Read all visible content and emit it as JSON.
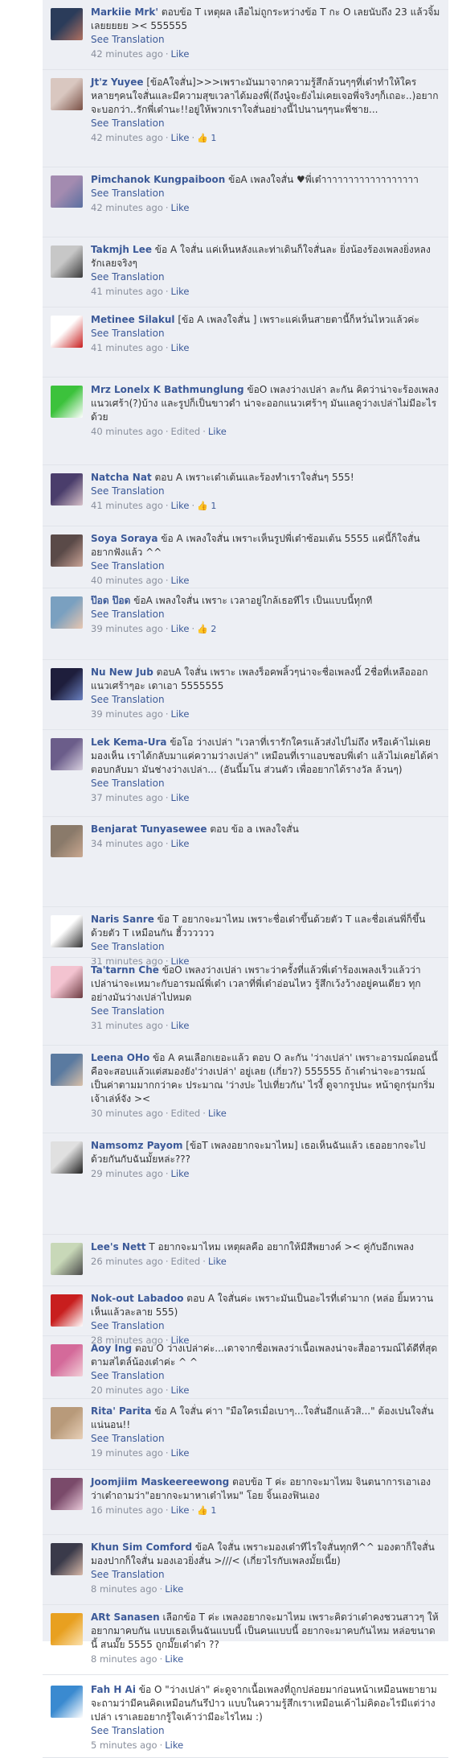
{
  "labels": {
    "see_translation": "See Translation",
    "like": "Like",
    "edited": "Edited",
    "thumb": "👍"
  },
  "comments": [
    {
      "name": "Markiie Mrk'",
      "text": "ตอบข้อ T เหตุผล เลือไม่ถูกระหว่างข้อ T กะ O เลยนับถึง 23 แล้วจิ้มเลยยยยย >< 555555",
      "time": "42 minutes ago",
      "see": true,
      "edited": false,
      "likes": "",
      "avatar": [
        "#2b3c5a",
        "#b07060"
      ]
    },
    {
      "name": "Jt'z Yuyee",
      "text": "[ข้อAใจสั่น]>>>เพราะมันมาจากความรู้สึกล้วนๆๆที่เต๋าทำให้ใครหลายๆคนใจสั่นและมีความสุขเวลาได้มองพี่(ถึงนู๋จะยังไม่เคยเจอพี่จริงๆก็เถอะ..)อยากจะบอกว่า..รักพี่เต๋านะ!!อยู่ให้พวกเราใจสั่นอย่างนี้ไปนานๆๆนะพี่ชาย...",
      "time": "42 minutes ago",
      "see": true,
      "edited": false,
      "likes": "1",
      "avatar": [
        "#d9c7c0",
        "#7a5045"
      ]
    },
    {
      "name": "Pimchanok Kungpaiboon",
      "text": "ข้อA เพลงใจสั่น ♥พี่เต๋าาาาาาาาาาาาาาาาาา",
      "time": "42 minutes ago",
      "see": true,
      "edited": false,
      "likes": "",
      "avatar": [
        "#a38bb0",
        "#5a6fa0"
      ]
    },
    {
      "name": "Takmjh Lee",
      "text": "ข้อ A ใจสั่น แค่เห็นหลังและท่าเดินก็ใจสั่นละ ยิ่งน้องร้องเพลงยิ่งหลงรักเลยจริงๆ",
      "time": "41 minutes ago",
      "see": true,
      "edited": false,
      "likes": "",
      "avatar": [
        "#c7c7c7",
        "#3a3a3a"
      ]
    },
    {
      "name": "Metinee Silakul",
      "text": "[ข้อ A เพลงใจสั่น ] เพราะแค่เห็นสายตานี้ก็หวั่นไหวแล้วค่ะ",
      "time": "41 minutes ago",
      "see": true,
      "edited": false,
      "likes": "",
      "avatar": [
        "#ffffff",
        "#c81e1e"
      ]
    },
    {
      "name": "Mrz Lonelx K Bathmunglung",
      "text": "ข้อO เพลงว่างเปล่า ละกัน คิดว่าน่าจะร้องเพลงแนวเศร้า(?)บ้าง และรูปก็เป็นขาวดำ น่าจะออกแนวเศร้าๆ มันแลดูว่างเปล่าไม่มีอะไรด้วย",
      "time": "40 minutes ago",
      "see": false,
      "edited": true,
      "likes": "",
      "avatar": [
        "#3cc23c",
        "#ffffff"
      ]
    },
    {
      "name": "Natcha Nat",
      "text": "ตอบ A เพราะเต๋าเต้นและร้องทำเราใจสั่นๆ 555!",
      "time": "41 minutes ago",
      "see": true,
      "edited": false,
      "likes": "1",
      "avatar": [
        "#4a3d6b",
        "#d6c0c8"
      ]
    },
    {
      "name": "Soya Soraya",
      "text": "ข้อ A เพลงใจสั่น เพราะเห็นรูปพี่เต๋าซ้อมเต้น 5555 แค่นี้ก็ใจสั่นอยากฟังแล้ว ^^",
      "time": "40 minutes ago",
      "see": true,
      "edited": false,
      "likes": "",
      "avatar": [
        "#5a4a48",
        "#c9a396"
      ]
    },
    {
      "name": "ป๊อด ป๊อด",
      "text": "ข้อA เพลงใจสั่น เพราะ เวลาอยู่ใกล้เธอทีไร เป็นแบบนี้ทุกที",
      "time": "39 minutes ago",
      "see": true,
      "edited": false,
      "likes": "2",
      "avatar": [
        "#7aa0c0",
        "#e8c6b0"
      ]
    },
    {
      "name": "Nu New Jub",
      "text": "ตอบA ใจสั่น เพราะ เพลงร็อคพลิ้วๆน่าจะชื่อเพลงนี้ 2ชื่อที่เหลือออกแนวเศร้าๆอะ เดาเอา 5555555",
      "time": "39 minutes ago",
      "see": true,
      "edited": false,
      "likes": "",
      "avatar": [
        "#1e1e3c",
        "#6a80c0"
      ]
    },
    {
      "name": "Lek Kema-Ura",
      "text": "ข้อโอ ว่างเปล่า \"เวลาที่เรารักใครแล้วส่งไปไม่ถึง หรือเค้าไม่เคยมองเห็น เราได้กลับมาแค่ความว่างเปล่า\" เหมือนที่เราแอบชอบพี่เต๋า แล้วไม่เคยได้ค่าตอบกลับมา มันช่างว่างเปล่า... (อันนี้มโน ส่วนตัว เพื่ออยากได้รางวัล ล้วนๆ)",
      "time": "37 minutes ago",
      "see": true,
      "edited": false,
      "likes": "",
      "avatar": [
        "#6b5d8a",
        "#d8d0e0"
      ]
    },
    {
      "name": "Benjarat Tunyasewee",
      "text": "ตอบ ข้อ a เพลงใจสั่น",
      "time": "34 minutes ago",
      "see": false,
      "edited": false,
      "likes": "",
      "avatar": [
        "#8a7a6a",
        "#caa890"
      ]
    },
    {
      "name": "Naris Sanre",
      "text": "ข้อ T อยากจะมาไหม เพราะชื่อเต๋าขึ้นด้วยตัว T และชื่อเล่นพี่ก็ขึ้นด้วยตัว T เหมือนกัน ฮี้วววววว",
      "time": "31 minutes ago",
      "see": true,
      "edited": false,
      "likes": "",
      "avatar": [
        "#ffffff",
        "#333333"
      ]
    },
    {
      "name": "Ta'tarnn Che",
      "text": "ข้อO เพลงว่างเปล่า เพราะว่าครั้งที่แล้วพี่เต๋าร้องเพลงเร็วแล้วว่าเปล่าน่าจะเหมาะกับอารมณ์พี่เต๋า เวลาที่พี่เต๋าอ่อนไหว รู้สึกเว้งว้างอยู่คนเดียว ทุกอย่างมันว่างเปล่าไปหมด",
      "time": "31 minutes ago",
      "see": true,
      "edited": false,
      "likes": "",
      "avatar": [
        "#f3c3d0",
        "#6b3a40"
      ]
    },
    {
      "name": "Leena OHo",
      "text": "ข้อ A คนเลือกเยอะแล้ว ตอบ O ละกัน 'ว่างเปล่า' เพราะอารมณ์ตอนนี้คือจะสอบแล้วแต่สมองยัง'ว่างเปล่า' อยู่เลย (เกี่ยว?) 555555 ถ้าเต๋าน่าจะอารมณ์เป็นค่าตามมากกว่าคะ ประมาณ 'ว่างปะ ไปเที่ยวกัน' ไรงี้ ดูจากรูปนะ หน้าดูกรุ่มกริ่ม เจ้าเล่ห์จัง ><",
      "time": "30 minutes ago",
      "see": false,
      "edited": true,
      "likes": "",
      "avatar": [
        "#5a7aa0",
        "#d9c0a8"
      ]
    },
    {
      "name": "Namsomz Payom",
      "text": "[ข้อT เพลงอยากจะมาไหม] เธอเห็นฉันแล้ว เธออยากจะไปด้วยกันกับฉันมั้ยหล่ะ???",
      "time": "29 minutes ago",
      "see": false,
      "edited": false,
      "likes": "",
      "avatar": [
        "#e0e0e0",
        "#202020"
      ]
    },
    {
      "name": "Lee's Nett",
      "text": "T อยากจะมาไหม เหตุผลคือ อยากให้มีสีพยางค์ >< คู่กับอีกเพลง",
      "time": "26 minutes ago",
      "see": false,
      "edited": true,
      "likes": "",
      "avatar": [
        "#c8d8b8",
        "#4a4a4a"
      ]
    },
    {
      "name": "Nok-out Labadoo",
      "text": "ตอบ A ใจสั่นค่ะ เพราะมันเป็นอะไรที่เต๋ามาก (หล่อ ยิ้มหวาน เห็นแล้วละลาย 555)",
      "time": "28 minutes ago",
      "see": true,
      "edited": false,
      "likes": "",
      "avatar": [
        "#c81e1e",
        "#ffffff"
      ]
    },
    {
      "name": "Aoy Ing",
      "text": "ตอบ O ว่างเปล่าค่ะ...เดาจากชื่อเพลงว่าเนื้อเพลงน่าจะสื่ออารมณ์ได้ดีที่สุดตามสไตล์น้องเต๋าค่ะ ^ ^",
      "time": "20 minutes ago",
      "see": true,
      "edited": false,
      "likes": "",
      "avatar": [
        "#d46a9a",
        "#f2d0d8"
      ]
    },
    {
      "name": "Rita' Parita",
      "text": "ข้อ A ใจสั่น ค่าา \"มือใครเมื่อเบาๆ...ใจสั่นอีกแล้วสิ...\" ต้องเปนใจสั่นแน่นอน!!",
      "time": "19 minutes ago",
      "see": true,
      "edited": false,
      "likes": "",
      "avatar": [
        "#b89a7a",
        "#e8d0b8"
      ]
    },
    {
      "name": "Joomjiim Maskeereewong",
      "text": "ตอบข้อ T ค่ะ อยากจะมาไหม จินตนาการเอาเองว่าเต๋าถามว่า\"อยากจะมาหาเต๋าไหม\" โอย จิ้นเองฟินเอง",
      "time": "16 minutes ago",
      "see": false,
      "edited": false,
      "likes": "1",
      "avatar": [
        "#7a4a6a",
        "#e8c8d8"
      ]
    },
    {
      "name": "Khun Sim Comford",
      "text": "ข้อA ใจสั่น เพราะมองเต๋าทีไรใจสั่นทุกที^^ มองตาก็ใจสั่น มองปากก็ใจสั่น มองเอวยิ่งสั่น >///< (เกี่ยวไรกับเพลงมั้ยเนี้ย)",
      "time": "8 minutes ago",
      "see": true,
      "edited": false,
      "likes": "",
      "avatar": [
        "#3a3a4a",
        "#d8b8a8"
      ]
    },
    {
      "name": "ARt Sanasen",
      "text": "เลือกข้อ T ค่ะ เพลงอยากจะมาไหม เพราะคิดว่าเต๋าคงชวนสาวๆ ให้อยากมาคบกัน แบบเธอเห็นฉันแบบนี้ เป็นคนแบบนี้ อยากจะมาคบกันไหม หล่อขนาดนี้ สนมั๊ย 5555 ถูกมั๊ยเต๋าต๋า ??",
      "time": "8 minutes ago",
      "see": false,
      "edited": false,
      "likes": "",
      "avatar": [
        "#e8a020",
        "#fbe2b0"
      ]
    },
    {
      "name": "Fah H Ai",
      "text": "ข้อ O \"ว่างเปล่า\" ค่ะดูจากเนื้อเพลงที่ถูกปล่อยมาก่อนหน้าเหมือนพยายามจะถามว่ามีคนคิดเหมือนกันรึป่าว แบบในความรู้สึกเราเหมือนเค้าไม่คิดอะไรมีแต่ว่างเปล่า เราเลยอยากรู้ใจเค้าว่ามีอะไรไหม :)",
      "time": "5 minutes ago",
      "see": true,
      "edited": false,
      "likes": "",
      "avatar": [
        "#3a8ad0",
        "#ffffff"
      ]
    }
  ]
}
